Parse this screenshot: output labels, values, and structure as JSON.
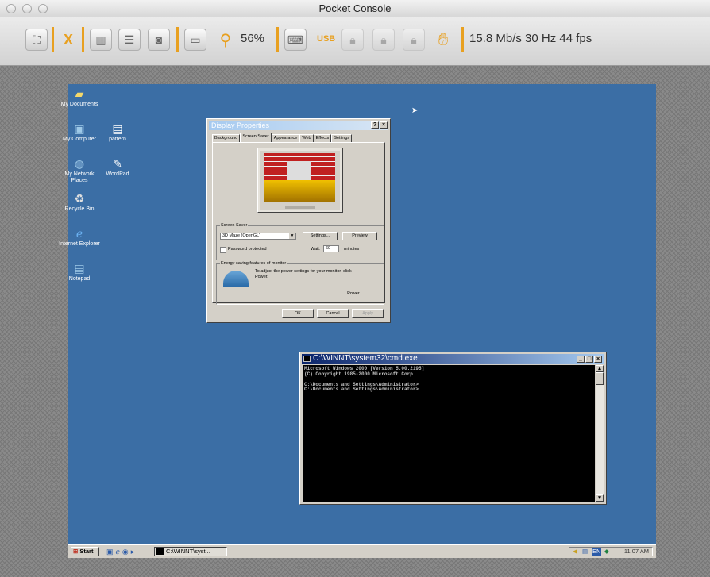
{
  "window": {
    "title": "Pocket Console"
  },
  "toolbar": {
    "zoom": "56%",
    "usb_label": "USB",
    "stats": "15.8 Mb/s  30 Hz  44 fps",
    "accent_color": "#e8a020"
  },
  "desktop": {
    "icons": [
      {
        "label": "My Documents"
      },
      {
        "label": "My Computer"
      },
      {
        "label": "pattern"
      },
      {
        "label": "My Network Places"
      },
      {
        "label": "WordPad"
      },
      {
        "label": "Recycle Bin"
      },
      {
        "label": "Internet Explorer"
      },
      {
        "label": "Notepad"
      }
    ],
    "background_color": "#3b6ea5"
  },
  "dialog": {
    "title": "Display Properties",
    "tabs": [
      {
        "label": "Background"
      },
      {
        "label": "Screen Saver"
      },
      {
        "label": "Appearance"
      },
      {
        "label": "Web"
      },
      {
        "label": "Effects"
      },
      {
        "label": "Settings"
      }
    ],
    "screensaver_group": "Screen Saver",
    "screensaver_value": "3D Maze (OpenGL)",
    "settings_label": "Settings...",
    "preview_label": "Preview",
    "password_label": "Password protected",
    "wait_label": "Wait:",
    "wait_value": "60",
    "minutes_label": "minutes",
    "energy_group": "Energy saving features of monitor",
    "energy_text": "To adjust the power settings for your monitor, click Power.",
    "power_label": "Power...",
    "ok_label": "OK",
    "cancel_label": "Cancel",
    "apply_label": "Apply"
  },
  "cmd": {
    "title": "C:\\WINNT\\system32\\cmd.exe",
    "lines": [
      "Microsoft Windows 2000 [Version 5.00.2195]",
      "(C) Copyright 1985-2000 Microsoft Corp.",
      "",
      "C:\\Documents and Settings\\Administrator>",
      "C:\\Documents and Settings\\Administrator>"
    ]
  },
  "taskbar": {
    "start_label": "Start",
    "task_label": "C:\\WINNT\\syst...",
    "clock": "11:07 AM"
  }
}
